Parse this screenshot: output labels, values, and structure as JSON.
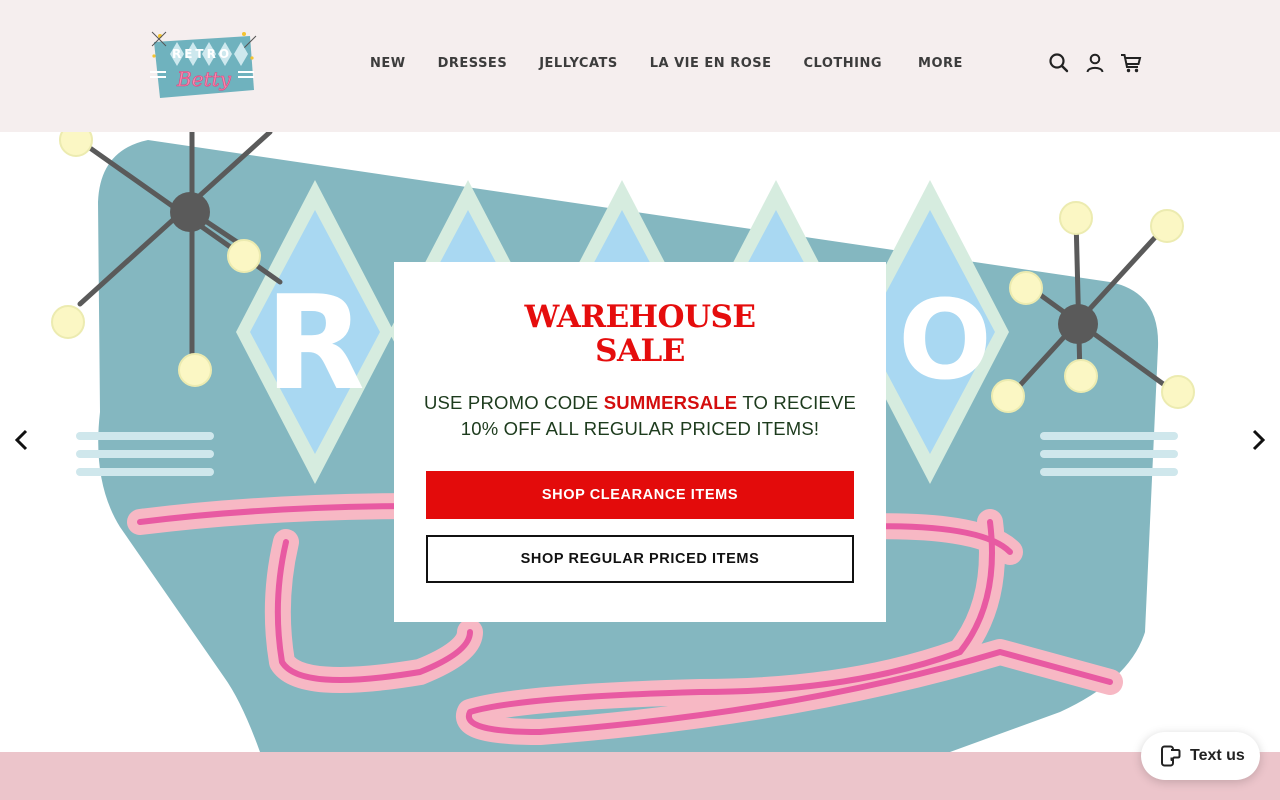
{
  "brand": {
    "logo_line1": "RETRO",
    "logo_line2": "Betty"
  },
  "nav": {
    "items": [
      {
        "label": "NEW"
      },
      {
        "label": "DRESSES"
      },
      {
        "label": "JELLYCATS"
      },
      {
        "label": "LA VIE EN ROSE"
      },
      {
        "label": "CLOTHING"
      },
      {
        "label": "MORE"
      }
    ]
  },
  "header_icons": [
    "search-icon",
    "account-icon",
    "cart-icon"
  ],
  "hero": {
    "art_letters": [
      "R",
      "O"
    ],
    "prev_icon": "chevron-left-icon",
    "next_icon": "chevron-right-icon"
  },
  "popup": {
    "title_line1": "WAREHOUSE",
    "title_line2": "SALE",
    "msg_prefix": "USE PROMO CODE ",
    "promo_code": "SUMMERSALE",
    "msg_suffix": " TO RECIEVE",
    "msg_line2": "10% OFF ALL REGULAR PRICED ITEMS!",
    "primary_button": "SHOP CLEARANCE ITEMS",
    "secondary_button": "SHOP REGULAR PRICED ITEMS"
  },
  "chat_widget": {
    "label": "Text us",
    "icon": "phone-chat-icon"
  },
  "colors": {
    "header_bg": "#f5eeee",
    "accent_red": "#e30b0b",
    "teal": "#84b7c0",
    "pink": "#f7b8c4",
    "band_pink": "#ecc5cb"
  }
}
